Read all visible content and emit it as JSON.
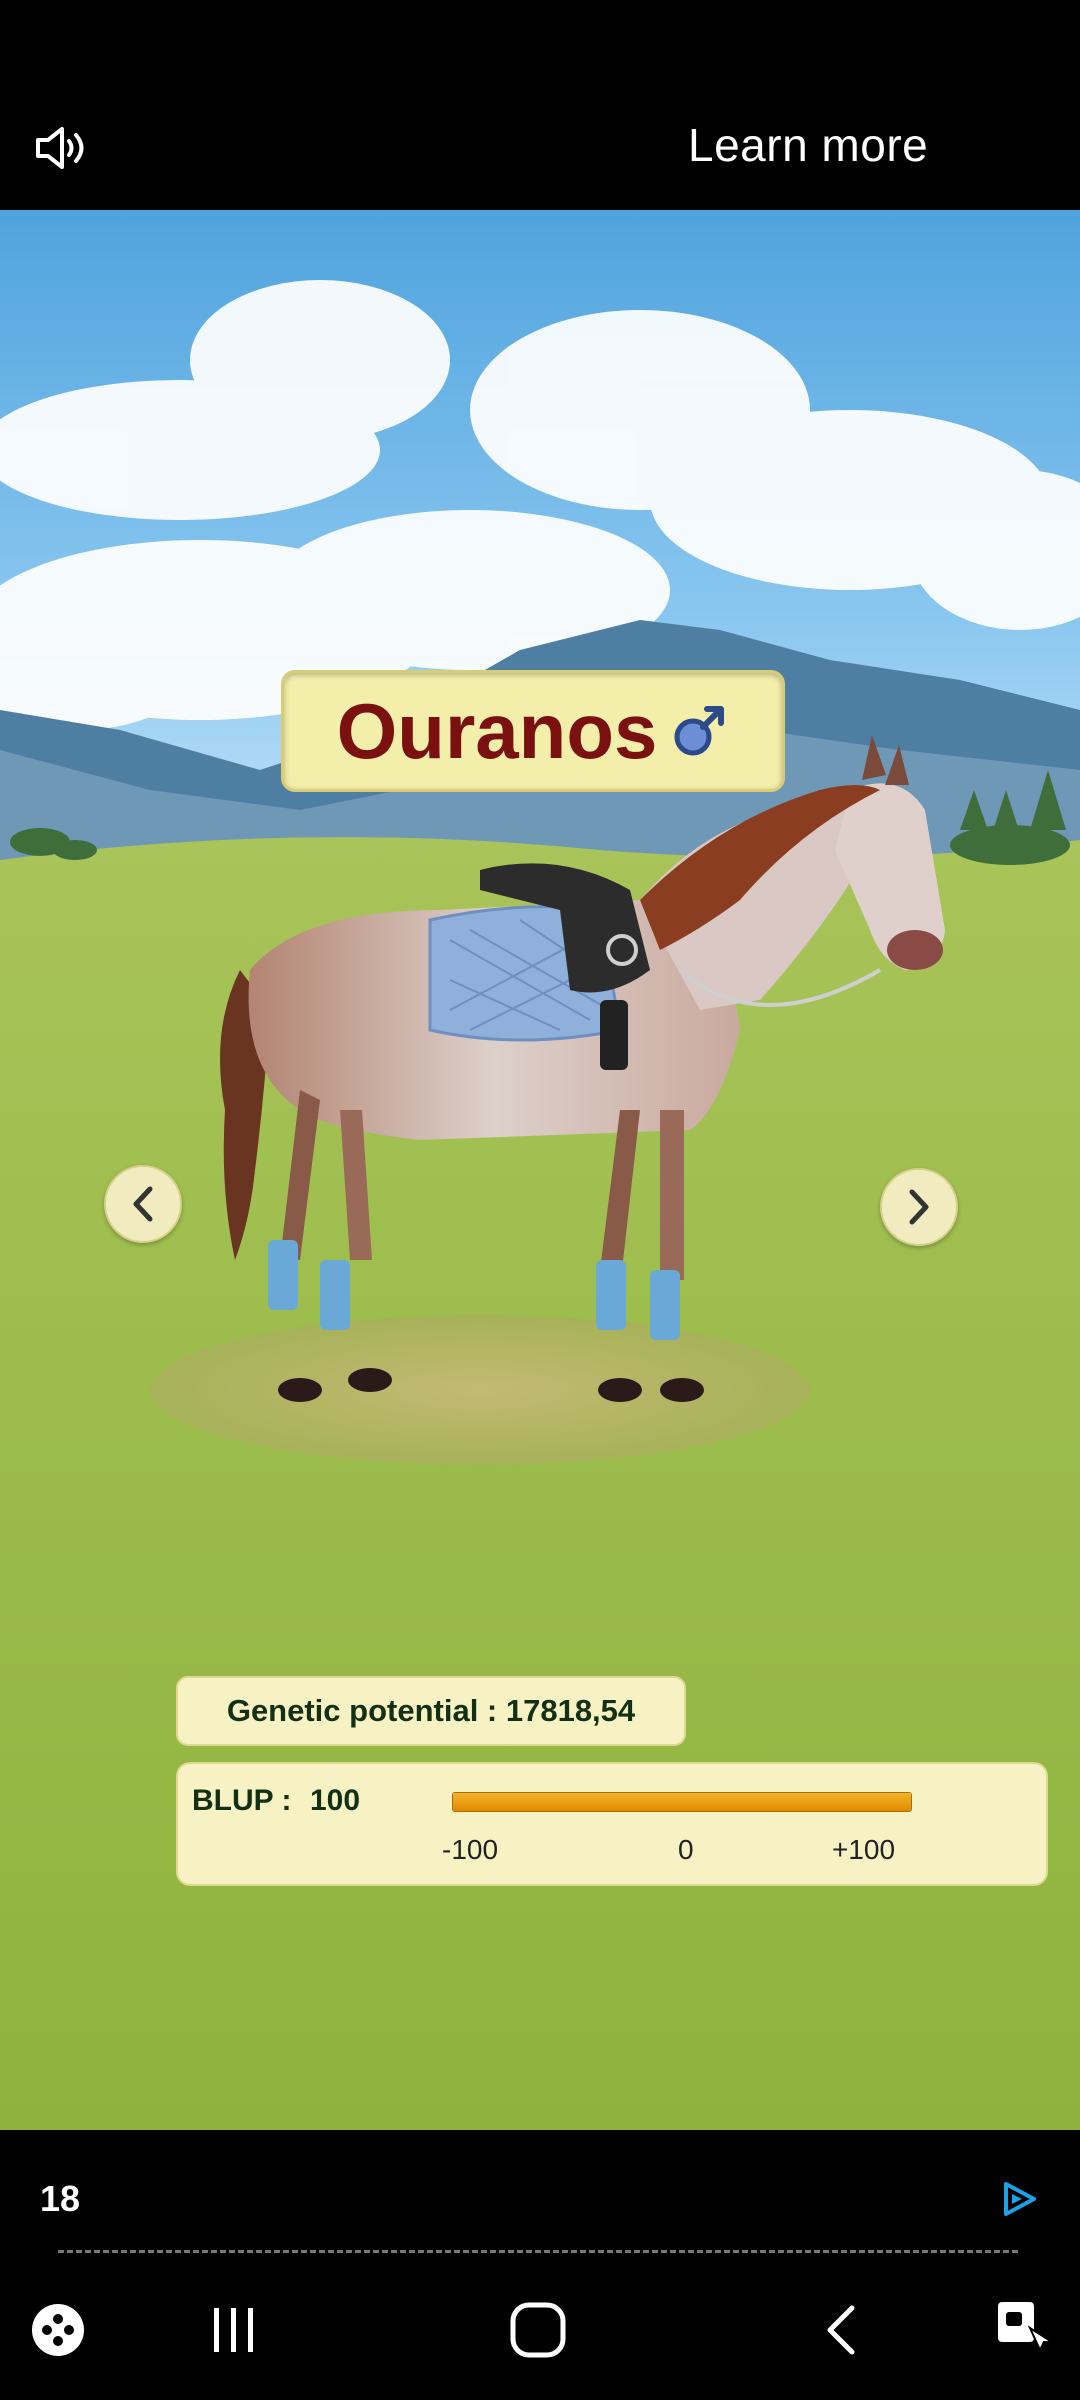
{
  "ad": {
    "learn_more": "Learn more",
    "counter": "18"
  },
  "horse": {
    "name": "Ouranos",
    "gender_icon": "male-symbol-icon",
    "genetic_potential": "Genetic potential  : 17818,54",
    "blup_label": "BLUP :",
    "blup_value": "100",
    "blup_fraction": 1.0,
    "blup_ticks": [
      "-100",
      "0",
      "+100"
    ]
  },
  "colors": {
    "name_text": "#7a1010",
    "panel_bg": "#f7f2c4",
    "bar_fill": "#f0a010",
    "accent": "#1aa3e8"
  },
  "icons": [
    "speaker-icon",
    "chevron-left-icon",
    "chevron-right-icon",
    "play-triangle-icon",
    "game-launcher-icon",
    "recent-apps-icon",
    "home-icon",
    "back-icon",
    "screen-assist-icon"
  ]
}
